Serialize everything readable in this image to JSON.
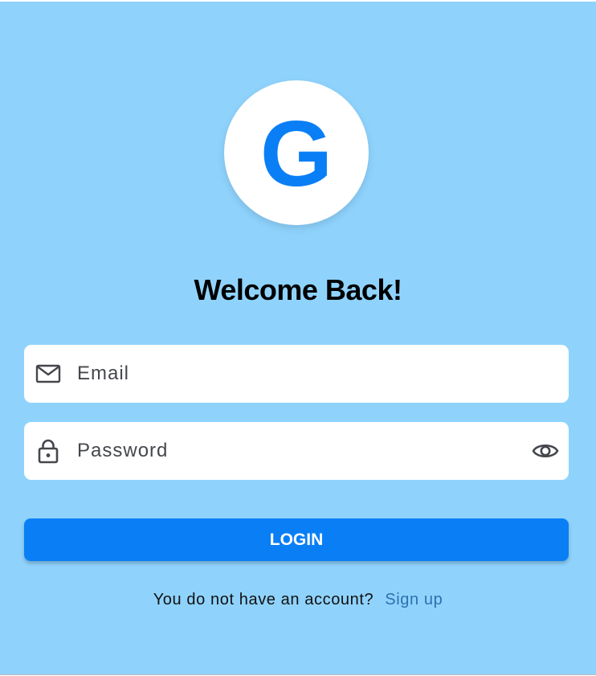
{
  "logo": {
    "letter": "G",
    "color": "#0a7ff5"
  },
  "heading": "Welcome Back!",
  "form": {
    "email": {
      "placeholder": "Email",
      "icon": "mail-icon"
    },
    "password": {
      "placeholder": "Password",
      "icon": "lock-icon",
      "toggle_icon": "eye-icon"
    },
    "login_label": "LOGIN"
  },
  "signup": {
    "prompt": "You do not have an account?",
    "link": "Sign up"
  },
  "colors": {
    "background": "#8fd3fd",
    "primary": "#0a7ff5",
    "link": "#2f6fae"
  }
}
